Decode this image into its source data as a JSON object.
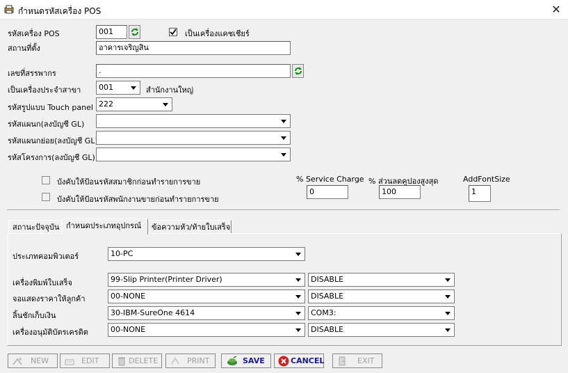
{
  "window": {
    "title": "กำหนดรหัสเครื่อง POS"
  },
  "pos_code": {
    "label": "รหัสเครื่อง POS",
    "value": "001"
  },
  "cashier_machine": {
    "label": "เป็นเครื่องแคชเชียร์",
    "checked": true
  },
  "location": {
    "label": "สถานที่ตั้ง",
    "value": "อาคารเจริญสิน"
  },
  "tax_no": {
    "label": "เลขที่สรรพากร",
    "value": "."
  },
  "branch": {
    "label": "เป็นเครื่องประจำสาขา",
    "value": "001",
    "name": "สำนักงานใหญ่"
  },
  "touch_panel": {
    "label": "รหัสรูปแบบ Touch panel",
    "value": "222"
  },
  "department": {
    "label": "รหัสแผนก(ลงบัญชี GL)",
    "value": ""
  },
  "sub_department": {
    "label": "รหัสแผนกย่อย(ลงบัญชี GL)",
    "value": ""
  },
  "project": {
    "label": "รหัสโครงการ(ลงบัญชี GL)",
    "value": ""
  },
  "options": {
    "require_member": {
      "label": "บังคับให้ป้อนรหัสสมาชิกก่อนทำรายการขาย",
      "checked": false
    },
    "require_salesperson": {
      "label": "บังคับให้ป้อนรหัสพนักงานขายก่อนทำรายการขาย",
      "checked": false
    }
  },
  "service_charge": {
    "label": "% Service Charge",
    "value": "0"
  },
  "max_discount": {
    "label": "% ส่วนลดคูปองสูงสุด",
    "value": "100"
  },
  "add_font_size": {
    "label": "AddFontSize",
    "value": "1"
  },
  "tabs": [
    {
      "label": "สถานะปัจจุบัน",
      "active": false
    },
    {
      "label": "กำหนดประเภทอุปกรณ์",
      "active": true
    },
    {
      "label": "ข้อความหัว/ท้ายใบเสร็จ",
      "active": false
    }
  ],
  "devices": {
    "computer_type": {
      "label": "ประเภทคอมพิวเตอร์",
      "value": "10-PC"
    },
    "receipt_printer": {
      "label": "เครื่องพิมพ์ใบเสร็จ",
      "value": "99-Slip Printer(Printer Driver)",
      "port": "DISABLE"
    },
    "customer_display": {
      "label": "จอแสดงราคาให้ลูกค้า",
      "value": "00-NONE",
      "port": "DISABLE"
    },
    "cash_drawer": {
      "label": "ลิ้นชักเก็บเงิน",
      "value": "30-IBM-SureOne 4614",
      "port": "COM3:"
    },
    "credit_terminal": {
      "label": "เครื่องอนุมัติบัตรเครดิต",
      "value": "00-NONE",
      "port": "DISABLE"
    }
  },
  "toolbar": {
    "new": "NEW",
    "edit": "EDIT",
    "delete": "DELETE",
    "print": "PRINT",
    "save": "SAVE",
    "cancel": "CANCEL",
    "exit": "EXIT"
  }
}
